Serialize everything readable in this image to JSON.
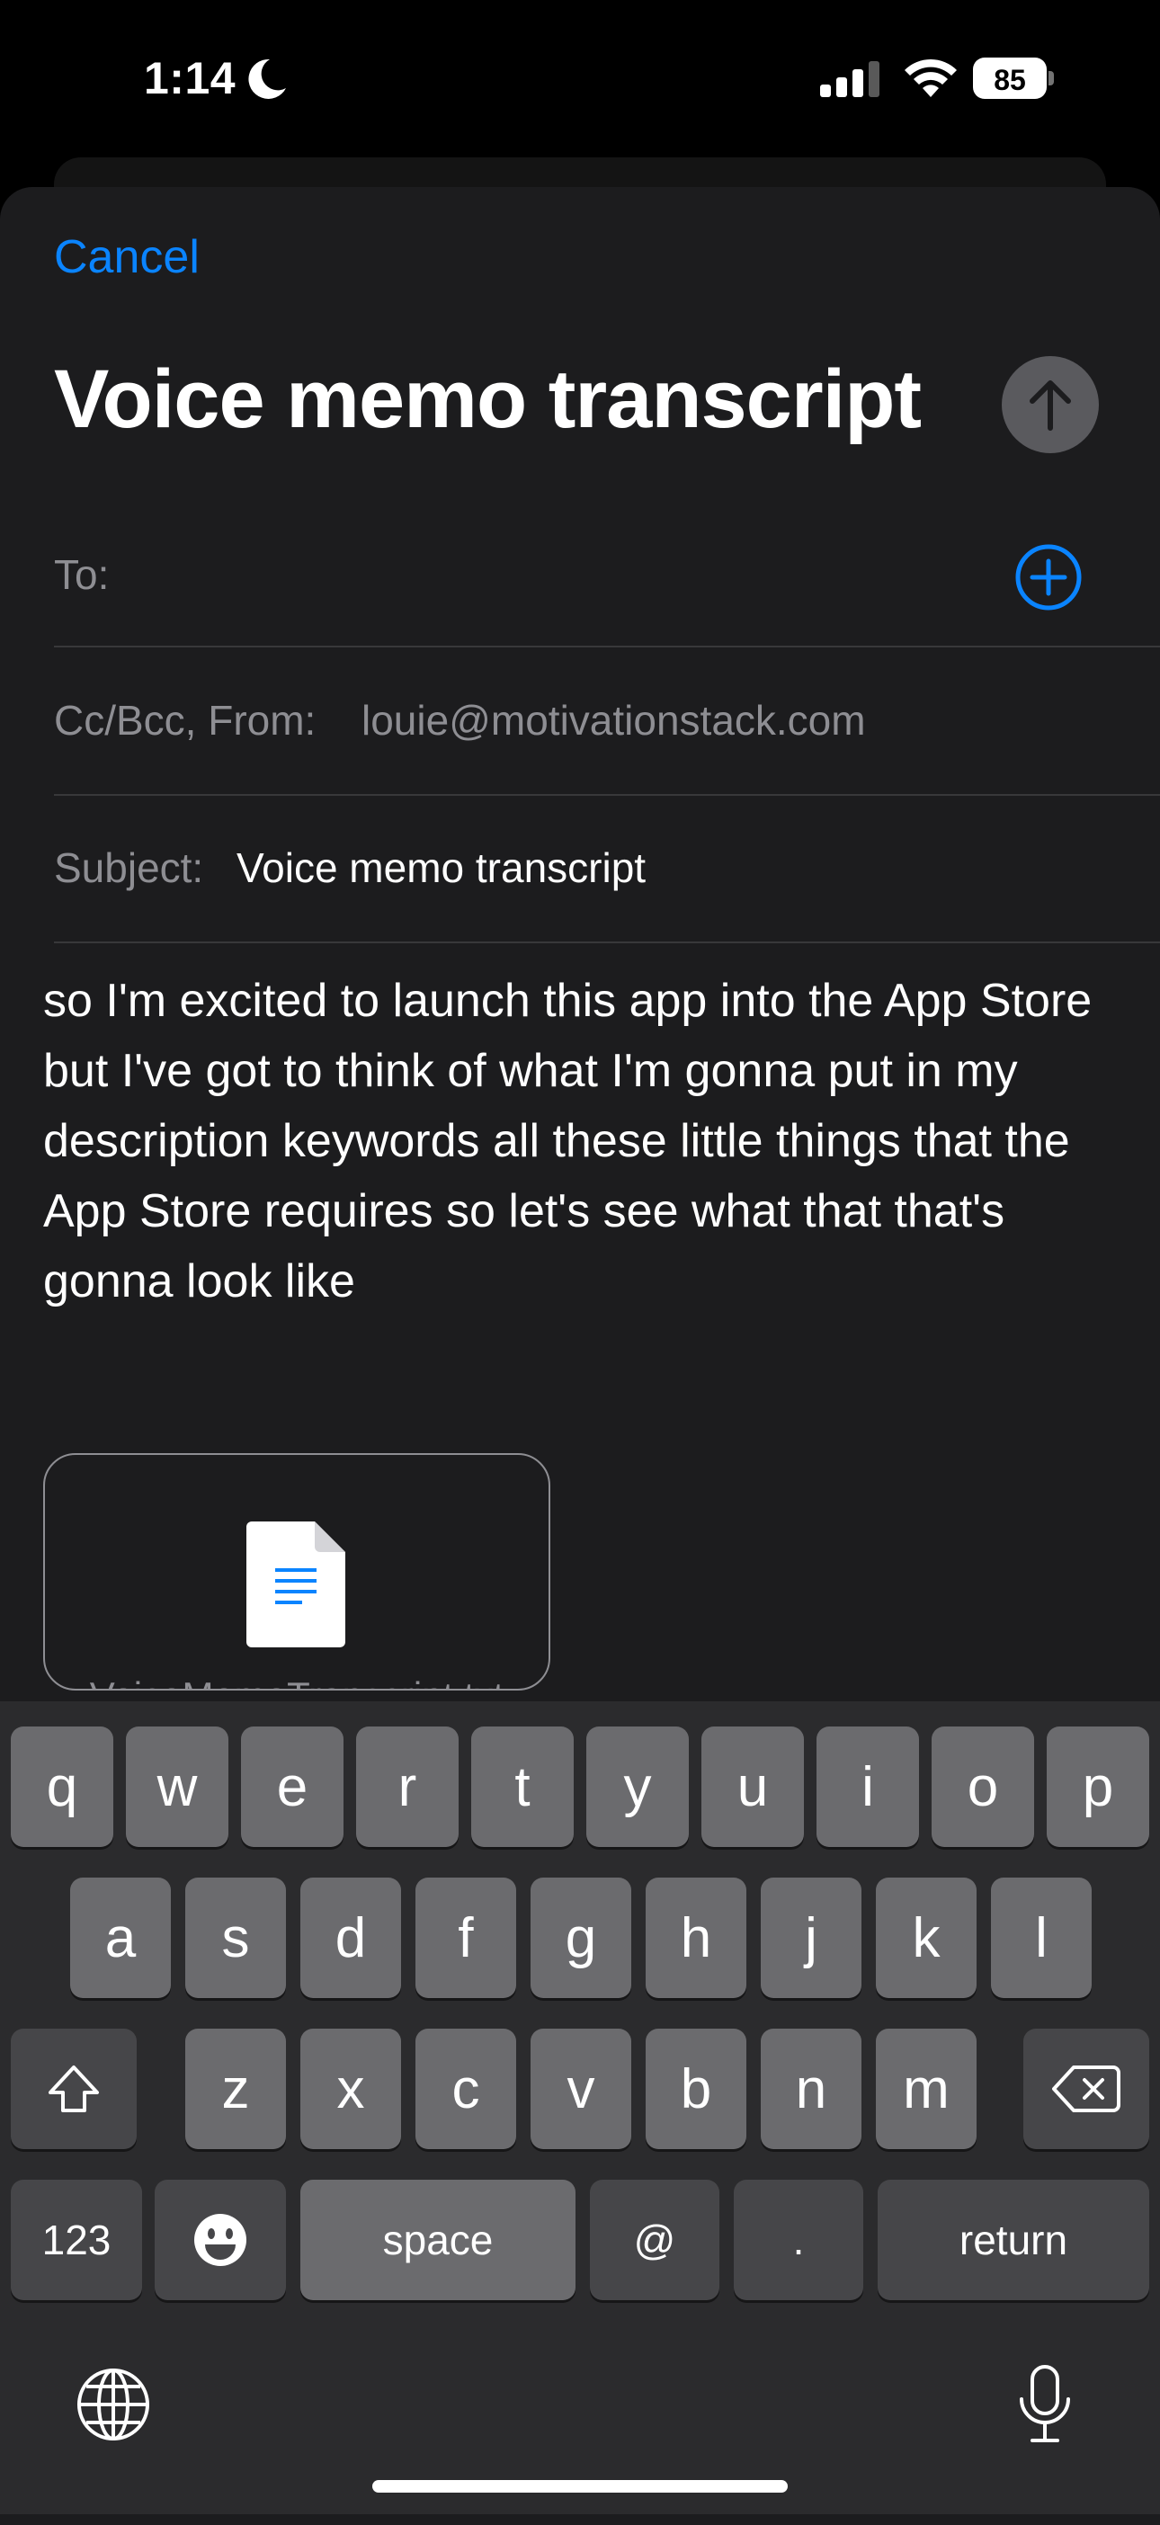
{
  "status_bar": {
    "time": "1:14",
    "battery": "85",
    "icons": [
      "moon-icon",
      "cellular-signal-icon",
      "wifi-icon",
      "battery-icon"
    ]
  },
  "compose": {
    "cancel_label": "Cancel",
    "title": "Voice memo transcript",
    "send_icon": "arrow-up-icon",
    "to_label": "To:",
    "add_contact_icon": "plus-circle-icon",
    "cc_bcc_from_label": "Cc/Bcc, From:",
    "from_value": "louie@motivationstack.com",
    "subject_label": "Subject:",
    "subject_value": "Voice memo transcript",
    "body": "so I'm excited to launch this app into the App Store but I've got to think of what I'm gonna put in my description keywords all these little things that the App Store requires so let's see what that that's gonna look like",
    "attachment": {
      "filename": "VoiceMemoTranscript.txt",
      "icon": "text-document-icon"
    }
  },
  "keyboard": {
    "row1": [
      "q",
      "w",
      "e",
      "r",
      "t",
      "y",
      "u",
      "i",
      "o",
      "p"
    ],
    "row2": [
      "a",
      "s",
      "d",
      "f",
      "g",
      "h",
      "j",
      "k",
      "l"
    ],
    "row3": [
      "z",
      "x",
      "c",
      "v",
      "b",
      "n",
      "m"
    ],
    "numbers_label": "123",
    "space_label": "space",
    "at_label": "@",
    "period_label": ".",
    "return_label": "return",
    "icons": [
      "shift-icon",
      "delete-icon",
      "emoji-icon",
      "globe-icon",
      "microphone-icon"
    ],
    "accent_color": "#0a84ff"
  }
}
